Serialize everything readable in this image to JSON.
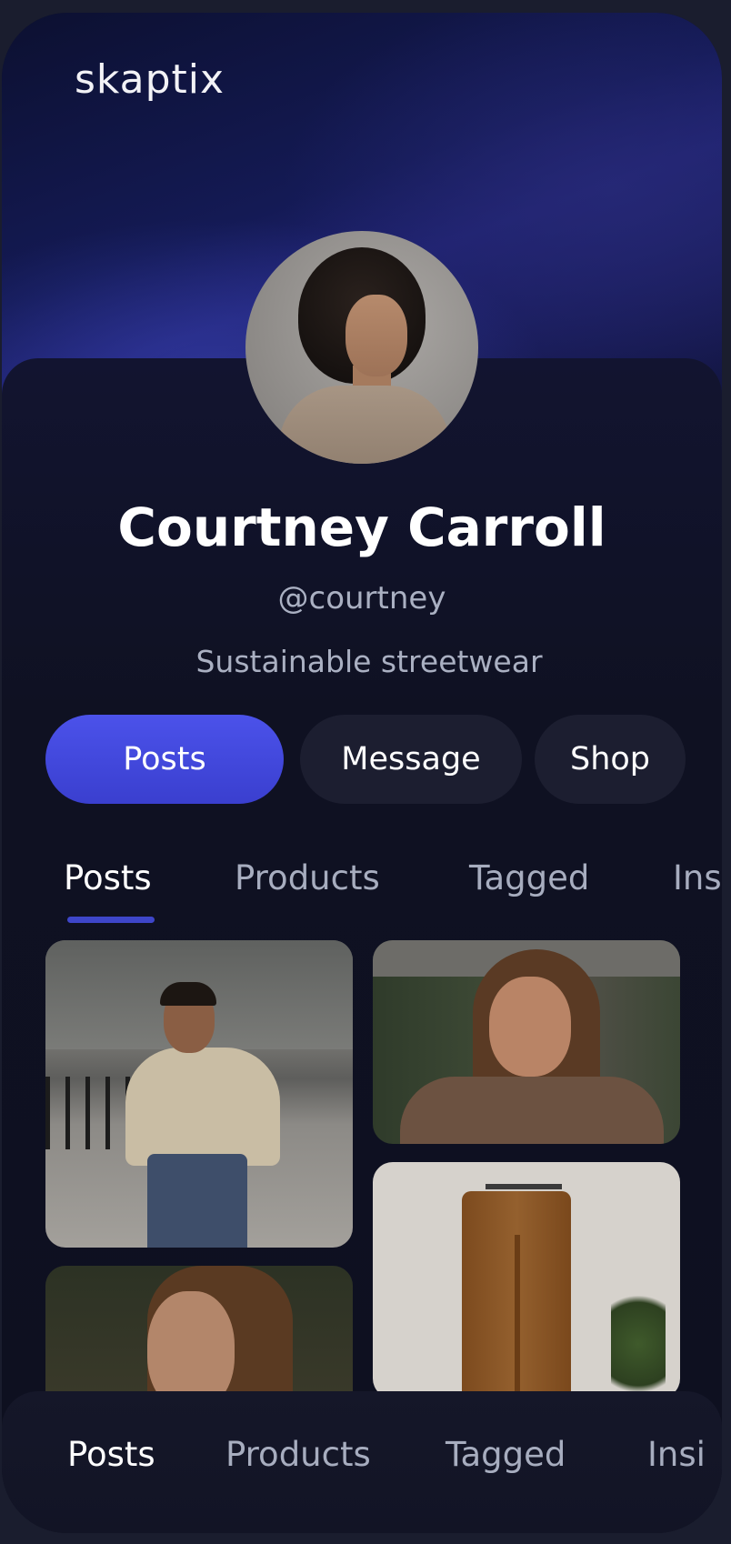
{
  "app": {
    "logo_text": "skaptix"
  },
  "profile": {
    "name": "Courtney Carroll",
    "handle": "@courtney",
    "bio": "Sustainable streetwear"
  },
  "actions": {
    "posts_label": "Posts",
    "message_label": "Message",
    "shop_label": "Shop"
  },
  "tabs": [
    {
      "label": "Posts",
      "active": true
    },
    {
      "label": "Products",
      "active": false
    },
    {
      "label": "Tagged",
      "active": false
    },
    {
      "label": "Ins",
      "active": false
    }
  ],
  "bottom_nav": [
    {
      "label": "Posts",
      "active": true
    },
    {
      "label": "Products",
      "active": false
    },
    {
      "label": "Tagged",
      "active": false
    },
    {
      "label": "Insi",
      "active": false
    }
  ],
  "colors": {
    "accent": "#4048df",
    "background": "#0e1020",
    "muted_text": "#a7adbf"
  }
}
